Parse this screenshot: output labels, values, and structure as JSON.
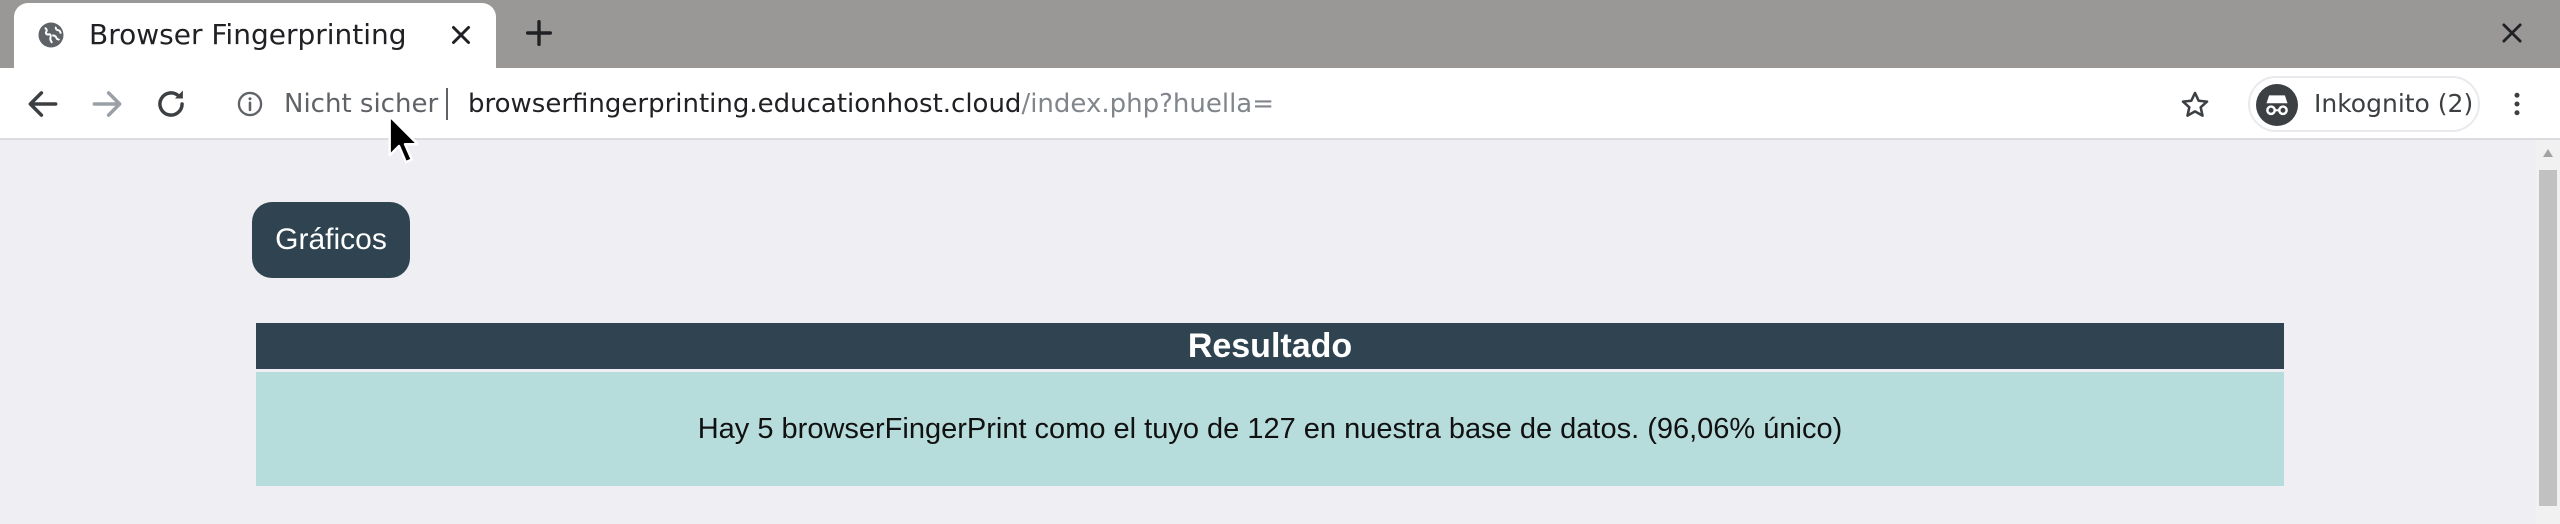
{
  "tab": {
    "title": "Browser Fingerprinting",
    "favicon": "globe-icon"
  },
  "toolbar": {
    "security_label": "Nicht sicher",
    "url_host": "browserfingerprinting.educationhost.cloud",
    "url_path": "/index.php?huella=",
    "profile_label": "Inkognito (2)"
  },
  "page": {
    "graficos_label": "Gráficos",
    "result_title": "Resultado",
    "result_text": "Hay 5 browserFingerPrint como el tuyo de 127 en nuestra base de datos. (96,06% único)"
  },
  "colors": {
    "tabstrip": "#999897",
    "page_background": "#efeef3",
    "primary_dark": "#2f4450",
    "result_background": "#b6dcdb"
  }
}
